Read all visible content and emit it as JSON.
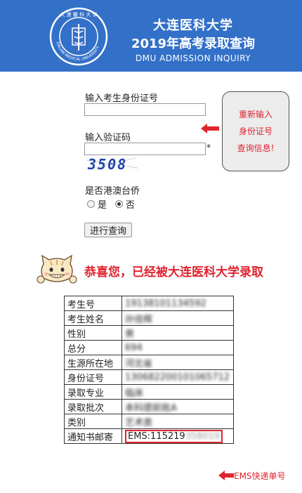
{
  "header": {
    "title_line1": "大连医科大学",
    "title_line2": "2019年高考录取查询",
    "title_line3": "DMU ADMISSION INQUIRY",
    "logo_text": "大 連 醫 科 大 學",
    "logo_text_en": "DALIAN MEDICAL UNIVERSITY",
    "bg_color": "#3370c8"
  },
  "form": {
    "id_label": "输入考生身份证号",
    "id_value": "",
    "captcha_label": "输入验证码",
    "captcha_value": "",
    "required_mark": "*",
    "captcha_image_text": "3508",
    "hk_label": "是否港澳台侨",
    "option_yes": "是",
    "option_no": "否",
    "selected_option": "否",
    "submit_label": "进行查询"
  },
  "callout": {
    "line1": "重新输入",
    "line2": "身份证号",
    "line3": "查询信息!"
  },
  "result": {
    "congrats": "恭喜您，已经被大连医科大学录取",
    "rows": [
      {
        "key": "考生号",
        "value": "19138101134592"
      },
      {
        "key": "考生姓名",
        "value": "孙佳辉"
      },
      {
        "key": "性别",
        "value": "男"
      },
      {
        "key": "总分",
        "value": "694"
      },
      {
        "key": "生源所在地",
        "value": "河北省"
      },
      {
        "key": "身份证号",
        "value": "130682200101065712"
      },
      {
        "key": "录取专业",
        "value": "临床"
      },
      {
        "key": "录取批次",
        "value": "本科提前批A"
      },
      {
        "key": "类别",
        "value": "艺术类"
      },
      {
        "key": "通知书邮寄",
        "value_visible": "EMS:115219",
        "value_hidden": "358019"
      }
    ],
    "ems_note": "EMS快递单号"
  },
  "colors": {
    "accent_red": "#e0242f"
  }
}
